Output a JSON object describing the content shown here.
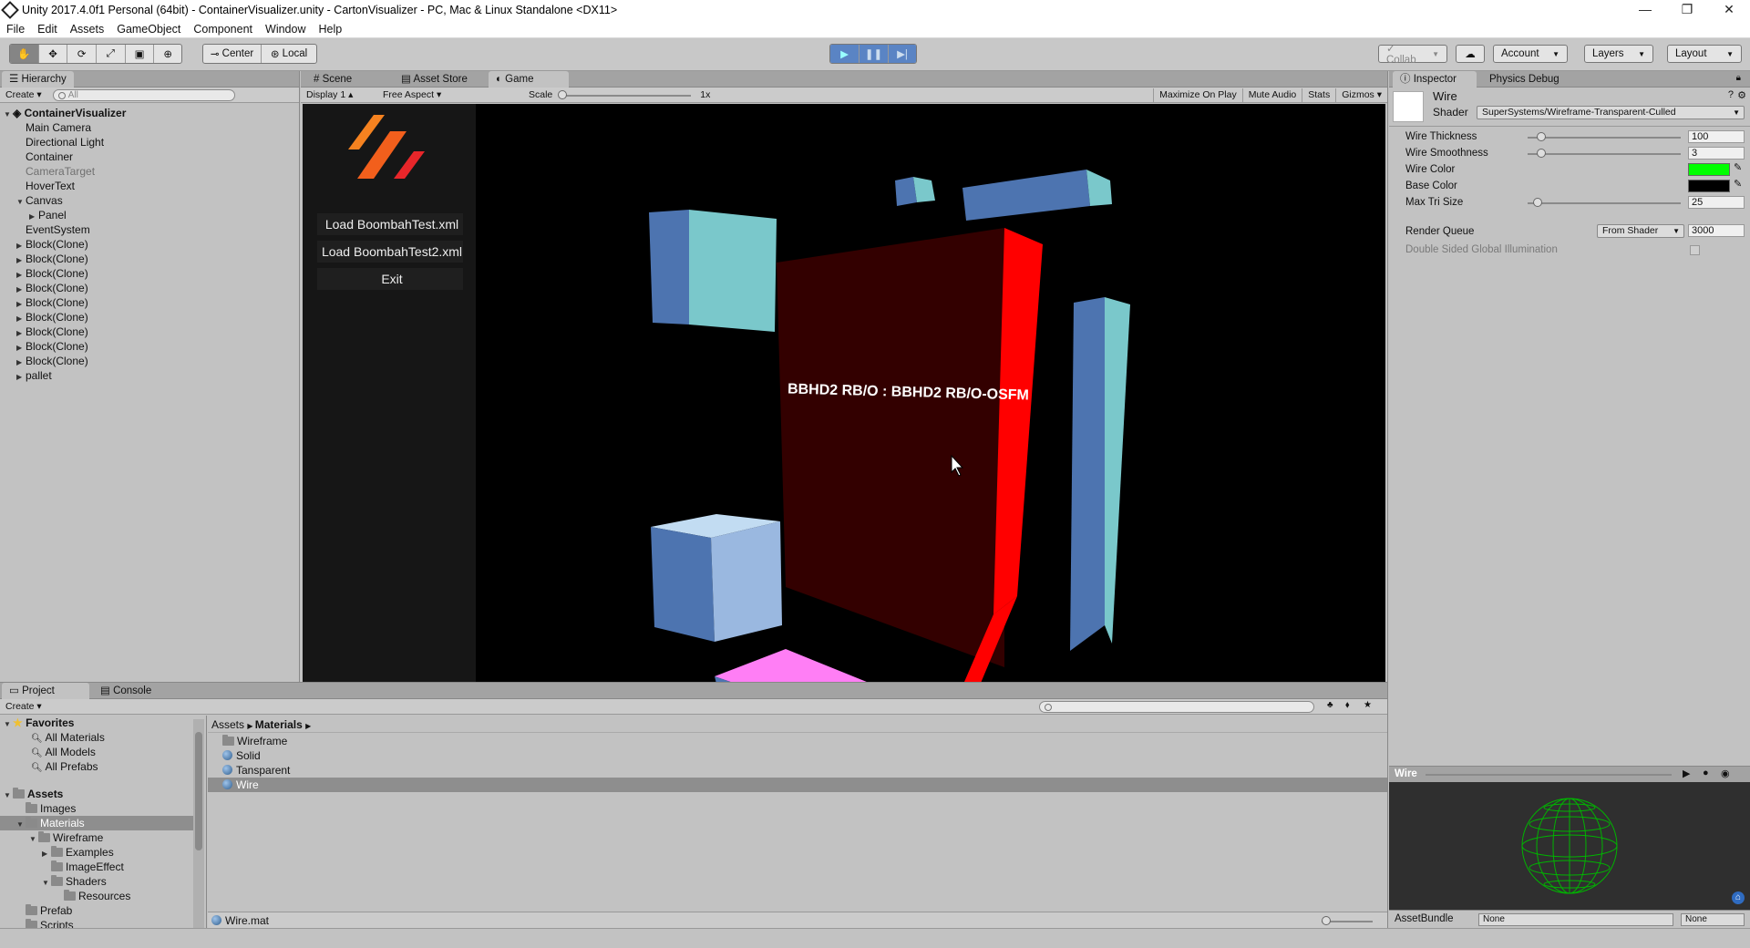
{
  "window": {
    "title": "Unity 2017.4.0f1 Personal (64bit) - ContainerVisualizer.unity - CartonVisualizer - PC, Mac & Linux Standalone <DX11>",
    "minimize": "—",
    "restore": "❐",
    "close": "✕"
  },
  "menu": [
    "File",
    "Edit",
    "Assets",
    "GameObject",
    "Component",
    "Window",
    "Help"
  ],
  "toolbar": {
    "pivot": "Center",
    "handle": "Local",
    "collab": "Collab",
    "account": "Account",
    "layers": "Layers",
    "layout": "Layout"
  },
  "hierarchy": {
    "tab": "Hierarchy",
    "create": "Create",
    "search_placeholder": "All",
    "scene": "ContainerVisualizer",
    "items": [
      {
        "label": "Main Camera",
        "indent": 1,
        "fold": "",
        "gray": false
      },
      {
        "label": "Directional Light",
        "indent": 1,
        "fold": "",
        "gray": false
      },
      {
        "label": "Container",
        "indent": 1,
        "fold": "",
        "gray": false
      },
      {
        "label": "CameraTarget",
        "indent": 1,
        "fold": "",
        "gray": true
      },
      {
        "label": "HoverText",
        "indent": 1,
        "fold": "",
        "gray": false
      },
      {
        "label": "Canvas",
        "indent": 1,
        "fold": "▼",
        "gray": false
      },
      {
        "label": "Panel",
        "indent": 2,
        "fold": "▶",
        "gray": false
      },
      {
        "label": "EventSystem",
        "indent": 1,
        "fold": "",
        "gray": false
      },
      {
        "label": "Block(Clone)",
        "indent": 1,
        "fold": "▶",
        "gray": false
      },
      {
        "label": "Block(Clone)",
        "indent": 1,
        "fold": "▶",
        "gray": false
      },
      {
        "label": "Block(Clone)",
        "indent": 1,
        "fold": "▶",
        "gray": false
      },
      {
        "label": "Block(Clone)",
        "indent": 1,
        "fold": "▶",
        "gray": false
      },
      {
        "label": "Block(Clone)",
        "indent": 1,
        "fold": "▶",
        "gray": false
      },
      {
        "label": "Block(Clone)",
        "indent": 1,
        "fold": "▶",
        "gray": false
      },
      {
        "label": "Block(Clone)",
        "indent": 1,
        "fold": "▶",
        "gray": false
      },
      {
        "label": "Block(Clone)",
        "indent": 1,
        "fold": "▶",
        "gray": false
      },
      {
        "label": "Block(Clone)",
        "indent": 1,
        "fold": "▶",
        "gray": false
      },
      {
        "label": "pallet",
        "indent": 1,
        "fold": "▶",
        "gray": false
      }
    ]
  },
  "center_tabs": {
    "scene": "Scene",
    "asset_store": "Asset Store",
    "game": "Game"
  },
  "game_bar": {
    "display": "Display 1",
    "aspect": "Free Aspect",
    "scale_label": "Scale",
    "scale_value": "1x",
    "maximize": "Maximize On Play",
    "mute": "Mute Audio",
    "stats": "Stats",
    "gizmos": "Gizmos"
  },
  "game_menu": {
    "buttons": [
      "Load BoombahTest.xml",
      "Load BoombahTest2.xml",
      "Exit"
    ]
  },
  "hover_text": "BBHD2 RB/O : BBHD2 RB/O-OSFM",
  "inspector": {
    "tab": "Inspector",
    "tab2": "Physics Debug",
    "material_name": "Wire",
    "shader_label": "Shader",
    "shader_value": "SuperSystems/Wireframe-Transparent-Culled",
    "props": [
      {
        "label": "Wire Thickness",
        "value": "100",
        "slider": 0.06
      },
      {
        "label": "Wire Smoothness",
        "value": "3",
        "slider": 0.06
      },
      {
        "label": "Wire Color",
        "value": "",
        "color": "#00ff00"
      },
      {
        "label": "Base Color",
        "value": "",
        "color": "#000000"
      },
      {
        "label": "Max Tri Size",
        "value": "25",
        "slider": 0.03
      }
    ],
    "render_queue_label": "Render Queue",
    "render_queue_mode": "From Shader",
    "render_queue_value": "3000",
    "dsgi_label": "Double Sided Global Illumination",
    "preview_title": "Wire",
    "assetbundle_label": "AssetBundle",
    "assetbundle_value": "None",
    "assetbundle_variant": "None"
  },
  "project": {
    "tab": "Project",
    "tab2": "Console",
    "create": "Create",
    "favorites_label": "Favorites",
    "favorites": [
      "All Materials",
      "All Models",
      "All Prefabs"
    ],
    "assets_label": "Assets",
    "tree": [
      {
        "label": "Images",
        "indent": 1,
        "fold": ""
      },
      {
        "label": "Materials",
        "indent": 1,
        "fold": "▼",
        "selected": true
      },
      {
        "label": "Wireframe",
        "indent": 2,
        "fold": "▼"
      },
      {
        "label": "Examples",
        "indent": 3,
        "fold": "▶"
      },
      {
        "label": "ImageEffect",
        "indent": 3,
        "fold": ""
      },
      {
        "label": "Shaders",
        "indent": 3,
        "fold": "▼"
      },
      {
        "label": "Resources",
        "indent": 4,
        "fold": ""
      },
      {
        "label": "Prefab",
        "indent": 1,
        "fold": ""
      },
      {
        "label": "Scripts",
        "indent": 1,
        "fold": ""
      }
    ],
    "breadcrumb": [
      "Assets",
      "Materials"
    ],
    "files": [
      {
        "label": "Wireframe",
        "type": "folder"
      },
      {
        "label": "Solid",
        "type": "material"
      },
      {
        "label": "Tansparent",
        "type": "material"
      },
      {
        "label": "Wire",
        "type": "material",
        "selected": true
      }
    ],
    "selected_file": "Wire.mat"
  }
}
